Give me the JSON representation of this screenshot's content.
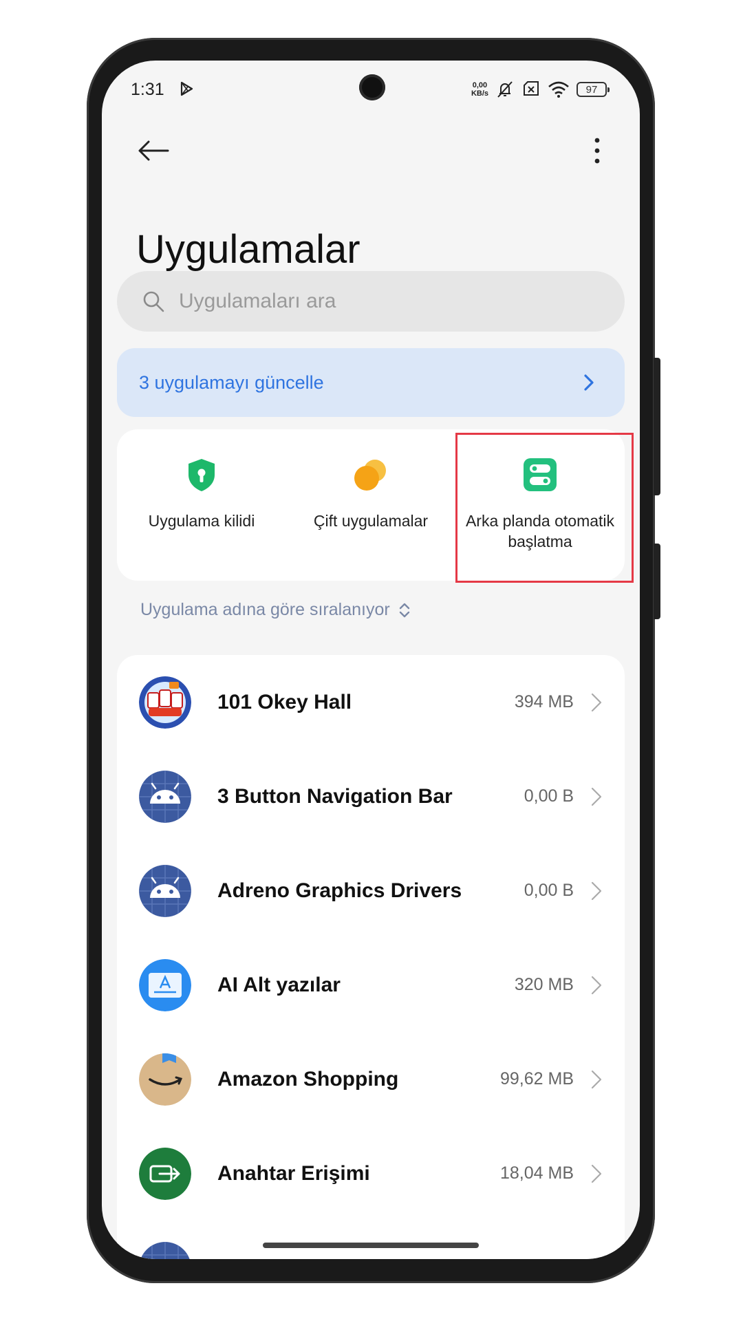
{
  "status_bar": {
    "time": "1:31",
    "net_speed_value": "0,00",
    "net_speed_unit": "KB/s",
    "battery": "97",
    "icons": [
      "play-store-icon",
      "mute-vibrate-icon",
      "sim-none-icon",
      "wifi-icon",
      "battery-icon"
    ]
  },
  "header": {
    "title": "Uygulamalar"
  },
  "search": {
    "placeholder": "Uygulamaları ara",
    "value": ""
  },
  "update_banner": {
    "label": "3 uygulamayı güncelle"
  },
  "shortcuts": [
    {
      "label": "Uygulama kilidi",
      "icon": "shield-key-icon",
      "color": "#1db86a"
    },
    {
      "label": "Çift uygulamalar",
      "icon": "dual-circles-icon",
      "color": "#f5a316"
    },
    {
      "label": "Arka planda otomatik başlatma",
      "icon": "toggle-switches-icon",
      "color": "#23c07e"
    }
  ],
  "highlight_color": "#e53946",
  "sort": {
    "label": "Uygulama adına göre sıralanıyor"
  },
  "apps": [
    {
      "name": "101 Okey Hall",
      "size": "394 MB",
      "icon": "okey-hall-icon"
    },
    {
      "name": "3 Button Navigation Bar",
      "size": "0,00 B",
      "icon": "android-icon"
    },
    {
      "name": "Adreno Graphics Drivers",
      "size": "0,00 B",
      "icon": "android-icon"
    },
    {
      "name": "AI Alt yazılar",
      "size": "320 MB",
      "icon": "subtitle-icon"
    },
    {
      "name": "Amazon Shopping",
      "size": "99,62 MB",
      "icon": "amazon-icon"
    },
    {
      "name": "Anahtar Erişimi",
      "size": "18,04 MB",
      "icon": "switch-access-icon"
    }
  ]
}
